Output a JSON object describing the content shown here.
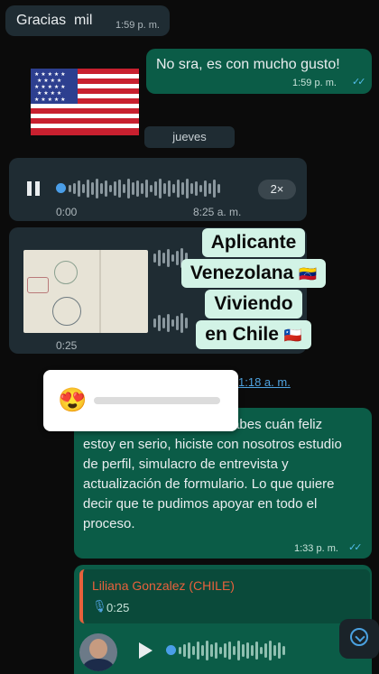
{
  "messages": {
    "m1": {
      "text": "Gracias  mil",
      "time": "1:59 p. m."
    },
    "m2": {
      "text": "No sra, es con mucho gusto!",
      "time": "1:59 p. m."
    },
    "day_divider": "jueves",
    "voice1": {
      "elapsed": "0:00",
      "time": "8:25 a. m.",
      "speed": "2×"
    },
    "voice2": {
      "elapsed": "0:25"
    },
    "partial_time": "1:18 a. m.",
    "m_long": {
      "text": "Bendito sea Dios!!!! No sabes cuán feliz estoy en serio, hiciste con nosotros estudio de perfil, simulacro de entrevista y actualización de formulario. Lo que quiere decir que te pudimos apoyar en todo el proceso.",
      "time": "1:33 p. m."
    },
    "reply": {
      "quoted_author": "Liliana Gonzalez (CHILE)",
      "quoted_duration": "0:25"
    }
  },
  "overlay": {
    "line1": "Aplicante",
    "line2": "Venezolana",
    "line3": "Viviendo",
    "line4": "en Chile"
  },
  "reaction_emoji": "😍",
  "flags": {
    "venezuela": "🇻🇪",
    "chile": "🇨🇱"
  },
  "colors": {
    "bg": "#0b0b0b",
    "incoming": "#1f2c33",
    "outgoing": "#0b5c47",
    "accent_tick": "#53bdeb",
    "reply_author": "#e8613c",
    "sticker_bg": "#d2f3e6"
  }
}
